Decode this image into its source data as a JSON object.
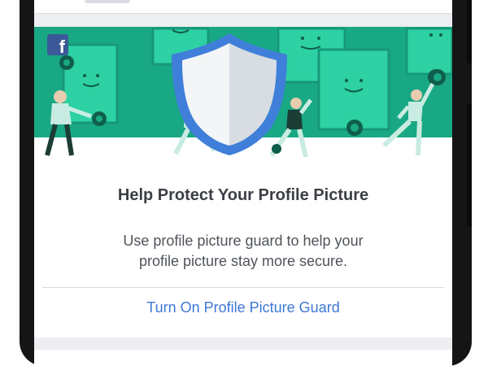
{
  "brand": {
    "logo_letter": "f",
    "color": "#3b5998"
  },
  "banner": {
    "background": "#19a884",
    "accent": "#2dd1a3",
    "shield_color": "#3f7fd9"
  },
  "card": {
    "title": "Help Protect Your Profile Picture",
    "description": "Use profile picture guard to help your profile picture stay more secure.",
    "action_label": "Turn On Profile Picture Guard"
  },
  "colors": {
    "link": "#3d77d6",
    "title_text": "#3b3f45",
    "body_text": "#4f545a"
  }
}
